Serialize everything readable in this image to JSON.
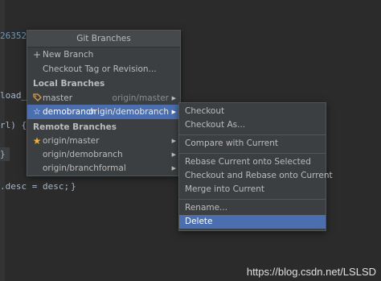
{
  "editor": {
    "lines": [
      {
        "text": "26352"
      },
      {
        "text": "load_"
      },
      {
        "text": "rl) {"
      },
      {
        "text": "}"
      },
      {
        "text": ".desc = desc;"
      },
      {
        "text": "}"
      }
    ]
  },
  "popup": {
    "title": "Git Branches",
    "new_branch": "New Branch",
    "checkout_tag": "Checkout Tag or Revision...",
    "local_header": "Local Branches",
    "local_branches": [
      {
        "name": "master",
        "tracking": "origin/master",
        "icon": "tag-icon"
      },
      {
        "name": "demobranch",
        "tracking": "origin/demobranch",
        "icon": "star-outline-icon"
      }
    ],
    "remote_header": "Remote Branches",
    "remote_branches": [
      {
        "name": "origin/master",
        "icon": "star-filled-icon"
      },
      {
        "name": "origin/demobranch"
      },
      {
        "name": "origin/branchformal"
      }
    ]
  },
  "submenu": {
    "items": [
      "Checkout",
      "Checkout As...",
      "Compare with Current",
      "Rebase Current onto Selected",
      "Checkout and Rebase onto Current",
      "Merge into Current",
      "Rename...",
      "Delete"
    ]
  },
  "watermark": "https://blog.csdn.net/LSLSD",
  "colors": {
    "selection": "#4b6eaf",
    "menu_bg": "#3c3f41",
    "editor_bg": "#2b2b2b",
    "star": "#f0b13a",
    "tag": "#d9a04b"
  }
}
